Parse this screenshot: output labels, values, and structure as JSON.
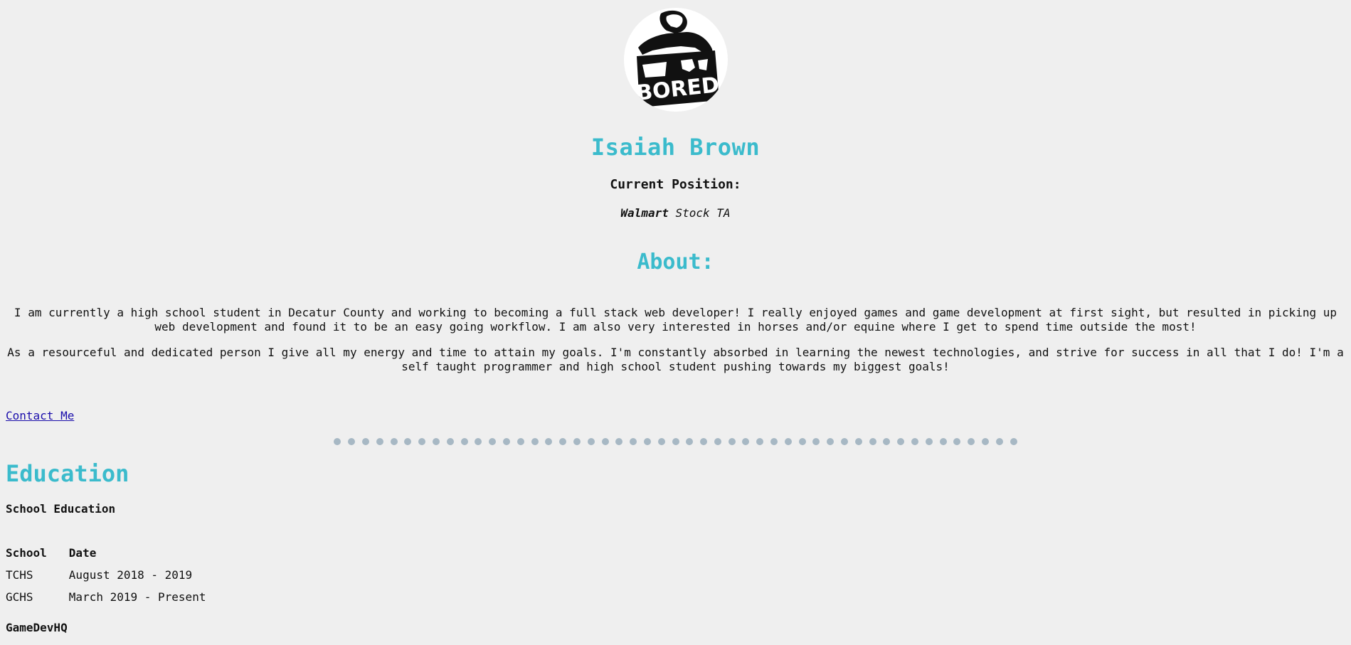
{
  "profile": {
    "name": "Isaiah Brown",
    "avatar_text": "BORED"
  },
  "position": {
    "heading": "Current Position:",
    "employer": "Walmart",
    "role": "Stock TA"
  },
  "about": {
    "heading": "About:",
    "paragraphs": [
      "I am currently a high school student in Decatur County and working to becoming a full stack web developer! I really enjoyed games and game development at first sight, but resulted in picking up web development and found it to be an easy going workflow. I am also very interested in horses and/or equine where I get to spend time outside the most!",
      "As a resourceful and dedicated person I give all my energy and time to attain my goals. I'm constantly absorbed in learning the newest technologies, and strive for success in all that I do! I'm a self taught programmer and high school student pushing towards my biggest goals!"
    ]
  },
  "contact": {
    "label": "Contact Me"
  },
  "colors": {
    "accent": "#3bbbcc",
    "background": "#efefef",
    "link": "#1a0dab",
    "divider_dot": "#a7b8c4"
  },
  "education": {
    "heading": "Education",
    "school_section": {
      "heading": "School Education",
      "columns": [
        "School",
        "Date"
      ],
      "rows": [
        [
          "TCHS",
          "August 2018 - 2019"
        ],
        [
          "GCHS",
          "March 2019 - Present"
        ]
      ]
    },
    "next_section_heading": "GameDevHQ"
  }
}
